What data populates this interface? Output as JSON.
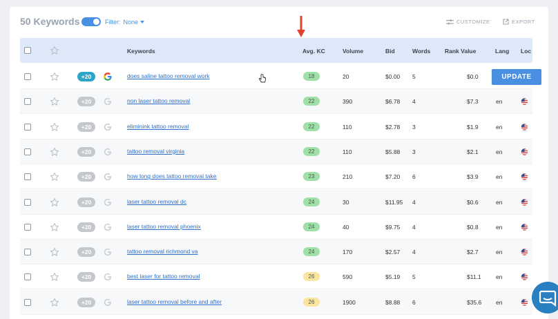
{
  "header": {
    "title": "50 Keywords",
    "filter_label": "Filter:",
    "filter_value": "None",
    "customize_label": "CUSTOMIZE",
    "export_label": "EXPORT"
  },
  "columns": {
    "keywords": "Keywords",
    "avg_kc": "Avg. KC",
    "volume": "Volume",
    "bid": "Bid",
    "words": "Words",
    "rank_value": "Rank Value",
    "lang": "Lang",
    "loc": "Loc"
  },
  "update_label": "UPDATE",
  "colors": {
    "accent": "#4a90e2",
    "kc_green": "#9fe0a9",
    "kc_yellow": "#fbe4a0",
    "arrow": "#e0432b"
  },
  "rows": [
    {
      "badge": "+20",
      "keyword": "does saline tattoo removal work",
      "kc": "18",
      "kc_color": "green",
      "volume": "20",
      "bid": "$0.00",
      "words": "5",
      "rank": "$0.0",
      "lang": "",
      "updating": true
    },
    {
      "badge": "+20",
      "keyword": "non laser tattoo removal",
      "kc": "22",
      "kc_color": "green",
      "volume": "390",
      "bid": "$6.78",
      "words": "4",
      "rank": "$7.3",
      "lang": "en"
    },
    {
      "badge": "+20",
      "keyword": "eliminink tattoo removal",
      "kc": "22",
      "kc_color": "green",
      "volume": "110",
      "bid": "$2.78",
      "words": "3",
      "rank": "$1.9",
      "lang": "en"
    },
    {
      "badge": "+20",
      "keyword": "tattoo removal virginia",
      "kc": "22",
      "kc_color": "green",
      "volume": "110",
      "bid": "$5.88",
      "words": "3",
      "rank": "$2.1",
      "lang": "en"
    },
    {
      "badge": "+20",
      "keyword": "how long does tattoo removal take",
      "kc": "23",
      "kc_color": "green",
      "volume": "210",
      "bid": "$7.20",
      "words": "6",
      "rank": "$3.9",
      "lang": "en"
    },
    {
      "badge": "+20",
      "keyword": "laser tattoo removal dc",
      "kc": "24",
      "kc_color": "green",
      "volume": "30",
      "bid": "$11.95",
      "words": "4",
      "rank": "$0.6",
      "lang": "en"
    },
    {
      "badge": "+20",
      "keyword": "laser tattoo removal phoenix",
      "kc": "24",
      "kc_color": "green",
      "volume": "40",
      "bid": "$9.75",
      "words": "4",
      "rank": "$0.8",
      "lang": "en"
    },
    {
      "badge": "+20",
      "keyword": "tattoo removal richmond va",
      "kc": "24",
      "kc_color": "green",
      "volume": "170",
      "bid": "$2.57",
      "words": "4",
      "rank": "$2.7",
      "lang": "en"
    },
    {
      "badge": "+20",
      "keyword": "best laser for tattoo removal",
      "kc": "26",
      "kc_color": "yellow",
      "volume": "590",
      "bid": "$5.19",
      "words": "5",
      "rank": "$11.1",
      "lang": "en"
    },
    {
      "badge": "+20",
      "keyword": "laser tattoo removal before and after",
      "kc": "26",
      "kc_color": "yellow",
      "volume": "1900",
      "bid": "$8.88",
      "words": "6",
      "rank": "$35.6",
      "lang": "en"
    }
  ]
}
